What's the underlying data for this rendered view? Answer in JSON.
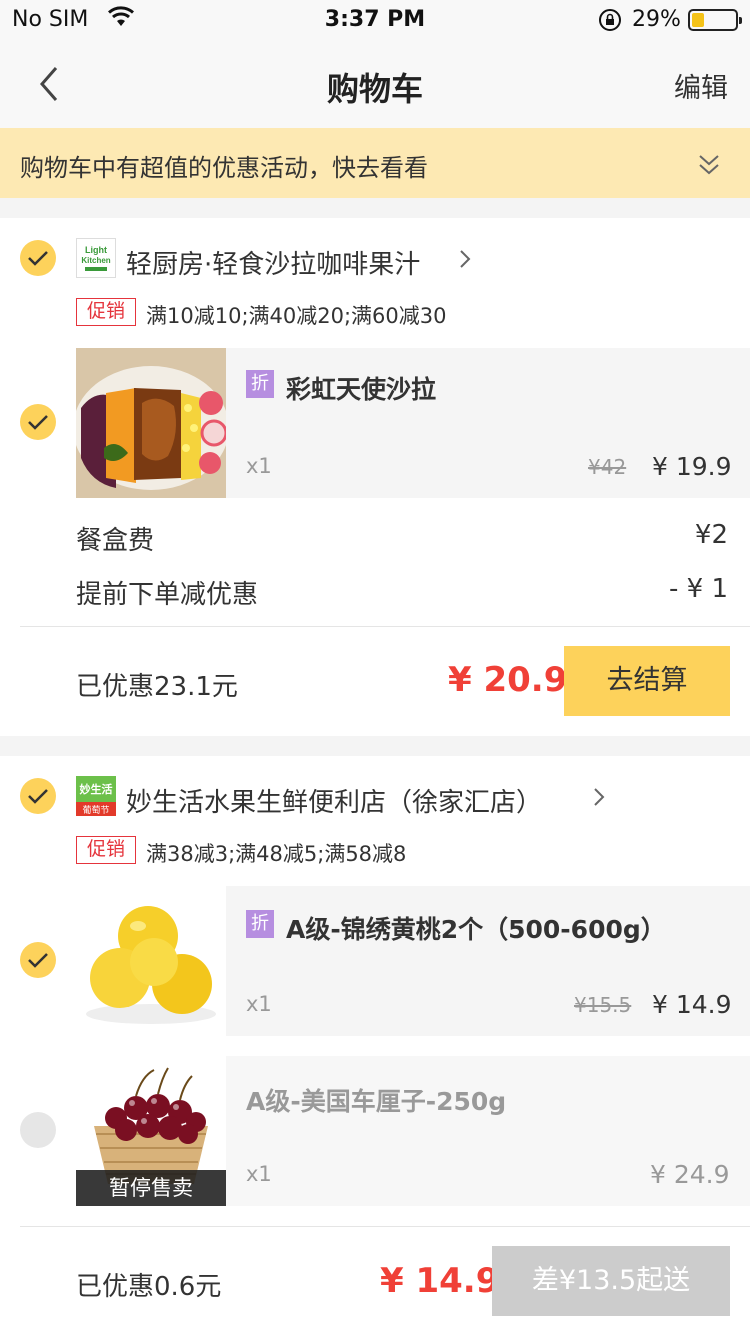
{
  "status_bar": {
    "carrier": "No SIM",
    "time": "3:37 PM",
    "battery": "29%"
  },
  "nav": {
    "title": "购物车",
    "edit": "编辑"
  },
  "banner": {
    "text": "购物车中有超值的优惠活动，快去看看"
  },
  "colors": {
    "accent": "#fdd25b",
    "price_red": "#f04037",
    "banner_bg": "#fde9b3",
    "tag_purple": "#b68ee0"
  },
  "shop1": {
    "name": "轻厨房·轻食沙拉咖啡果汁",
    "logo_text": "Light Kitchen",
    "promo_tag": "促销",
    "promo_text": "满10减10;满40减20;满60减30",
    "item": {
      "tag": "折",
      "name": "彩虹天使沙拉",
      "qty": "x1",
      "old_price": "¥42",
      "price": "¥ 19.9"
    },
    "fees": [
      {
        "label": "餐盒费",
        "value": "¥2"
      },
      {
        "label": "提前下单减优惠",
        "value": "- ¥ 1"
      }
    ],
    "saved": "已优惠23.1元",
    "total": "¥ 20.9",
    "checkout": "去结算"
  },
  "shop2": {
    "name": "妙生活水果生鲜便利店（徐家汇店）",
    "promo_tag": "促销",
    "promo_text": "满38减3;满48减5;满58减8",
    "items": [
      {
        "tag": "折",
        "name": "A级-锦绣黄桃2个（500-600g）",
        "qty": "x1",
        "old_price": "¥15.5",
        "price": "¥ 14.9"
      },
      {
        "name": "A级-美国车厘子-250g",
        "qty": "x1",
        "price": "¥ 24.9",
        "overlay": "暂停售卖"
      }
    ],
    "saved": "已优惠0.6元",
    "total": "¥ 14.9",
    "checkout": "差¥13.5起送"
  }
}
